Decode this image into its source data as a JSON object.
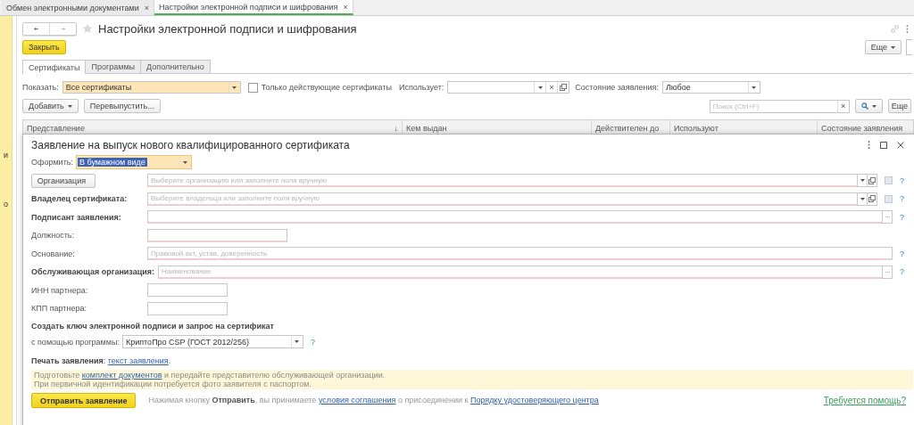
{
  "open_tabs": [
    {
      "label": "Обмен электронными документами",
      "close": "×",
      "selected": false
    },
    {
      "label": "Настройки электронной подписи и шифрования",
      "close": "×",
      "selected": true
    }
  ],
  "sidebar_fragments": [
    "и",
    "о"
  ],
  "page": {
    "title": "Настройки электронной подписи и шифрования",
    "close_button": "Закрыть",
    "more_button": "Еще",
    "tabs": [
      {
        "label": "Сертификаты",
        "selected": true
      },
      {
        "label": "Программы",
        "selected": false
      },
      {
        "label": "Дополнительно",
        "selected": false
      }
    ],
    "filter": {
      "show_label": "Показать:",
      "show_value": "Все сертификаты",
      "only_valid": {
        "label": "Только действующие сертификаты",
        "checked": false
      },
      "uses_label": "Использует:",
      "state_label": "Состояние заявления:",
      "state_value": "Любое"
    },
    "toolbar": {
      "add_button": "Добавить",
      "reissue_button": "Перевыпустить...",
      "search_placeholder": "Поиск (Ctrl+F)",
      "clear": "×",
      "more_button": "Еще"
    },
    "table": {
      "columns": [
        {
          "label": "Представление",
          "sort": "↓"
        },
        {
          "label": "Кем выдан"
        },
        {
          "label": "Действителен до"
        },
        {
          "label": "Используют"
        },
        {
          "label": "Состояние заявления"
        }
      ]
    }
  },
  "dialog": {
    "title": "Заявление на выпуск нового квалифицированного сертификата",
    "form_type": {
      "label": "Оформить:",
      "value": "В бумажном виде"
    },
    "fields": [
      {
        "kind": "ref",
        "label": "Организация",
        "label_button": true,
        "bold": false,
        "placeholder": "Выберите организацию или заполните поля вручную",
        "help": "?"
      },
      {
        "kind": "ref",
        "label": "Владелец сертификата:",
        "label_button": false,
        "bold": true,
        "placeholder": "Выберите владельца или заполните поля вручную",
        "help": "?"
      },
      {
        "kind": "pick",
        "label": "Подписант заявления:",
        "label_button": false,
        "bold": true,
        "help": "?"
      },
      {
        "kind": "medium",
        "label": "Должность:",
        "label_button": false,
        "bold": false
      },
      {
        "kind": "plain",
        "label": "Основание:",
        "label_button": false,
        "bold": false,
        "placeholder": "Правовой акт, устав, доверенность",
        "help": "?"
      },
      {
        "kind": "pick",
        "label": "Обслуживающая организация:",
        "label_button": false,
        "bold": true,
        "placeholder": "Наименование",
        "help": "?"
      },
      {
        "kind": "short",
        "label": "ИНН партнера:",
        "label_button": false,
        "bold": false
      },
      {
        "kind": "short",
        "label": "КПП партнера:",
        "label_button": false,
        "bold": false
      }
    ],
    "key_section": {
      "heading": "Создать ключ электронной подписи и запрос на сертификат",
      "program_label": "с помощью программы:",
      "program_value": "КриптоПро CSP (ГОСТ 2012/256)",
      "help": "?"
    },
    "print": {
      "label": "**Печать заявления**:",
      "link": "текст заявления",
      "end": "."
    },
    "note": {
      "before": "Подготовьте",
      "link": "комплект документов",
      "after": "и передайте представителю обслуживающей организации.",
      "line2": "При первичной идентификации потребуется фото заявителя с паспортом."
    },
    "send_button": "Отправить заявление",
    "agreement": {
      "text1": "Нажимая кнопку **Отправить**, вы принимаете",
      "link1": "условия соглашения",
      "text2": "о присоединении к",
      "link2": "Порядку удостоверяющего центра"
    },
    "help_link": "Требуется помощь?"
  }
}
